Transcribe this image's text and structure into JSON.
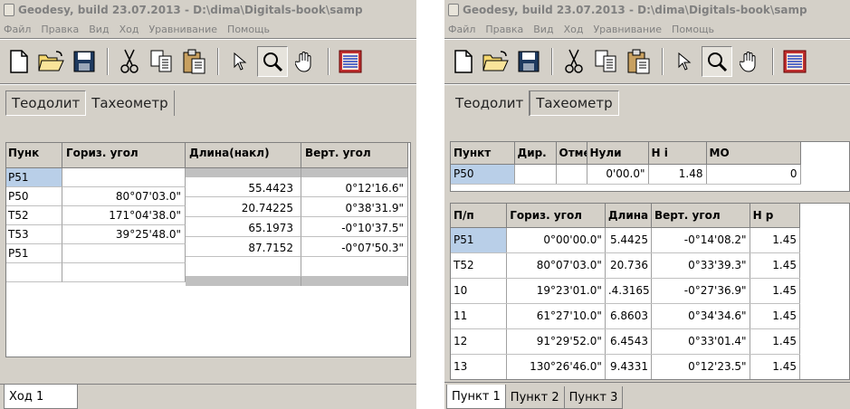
{
  "window1": {
    "title": "Geodesy, build 23.07.2013 - D:\\dima\\Digitals-book\\samp",
    "menu": [
      "Файл",
      "Правка",
      "Вид",
      "Ход",
      "Уравнивание",
      "Помощь"
    ],
    "tabs": [
      "Теодолит",
      "Тахеометр"
    ],
    "grid_headers": [
      "Пунк",
      "Гориз. угол",
      "Длина(накл)",
      "Верт. угол"
    ],
    "points": [
      {
        "name": "P51",
        "angle": "",
        "length": "",
        "vert": ""
      },
      {
        "name": "P50",
        "angle": "80°07'03.0\"",
        "length": "55.4423",
        "vert": "0°12'16.6\""
      },
      {
        "name": "T52",
        "angle": "171°04'38.0\"",
        "length": "20.74225",
        "vert": "0°38'31.9\""
      },
      {
        "name": "T53",
        "angle": "39°25'48.0\"",
        "length": "65.1973",
        "vert": "-0°10'37.5\""
      },
      {
        "name": "P51",
        "angle": "",
        "length": "87.7152",
        "vert": "-0°07'50.3\""
      }
    ],
    "bottom_tab": "Ход 1"
  },
  "window2": {
    "title": "Geodesy, build 23.07.2013 - D:\\dima\\Digitals-book\\samp",
    "menu": [
      "Файл",
      "Правка",
      "Вид",
      "Ход",
      "Уравнивание",
      "Помощь"
    ],
    "tabs": [
      "Теодолит",
      "Тахеометр"
    ],
    "station_headers": [
      "Пункт",
      "Дир. ",
      "Отме",
      "Нули",
      "H i",
      "MO"
    ],
    "station_row": [
      "P50",
      "",
      "",
      "0'00.0\"",
      "1.48",
      "0"
    ],
    "obs_headers": [
      "П/п",
      "Гориз. угол",
      "Длина",
      "Верт. угол",
      "H р"
    ],
    "obs_rows": [
      [
        "P51",
        "0°00'00.0\"",
        "5.4425",
        "-0°14'08.2\"",
        "1.45"
      ],
      [
        "T52",
        "80°07'03.0\"",
        "20.736",
        "0°33'39.3\"",
        "1.45"
      ],
      [
        "10",
        "19°23'01.0\"",
        ".4.3165",
        "-0°27'36.9\"",
        "1.45"
      ],
      [
        "11",
        "61°27'10.0\"",
        "6.8603",
        "0°34'34.6\"",
        "1.45"
      ],
      [
        "12",
        "91°29'52.0\"",
        "6.4543",
        "0°33'01.4\"",
        "1.45"
      ],
      [
        "13",
        "130°26'46.0\"",
        "9.4331",
        "0°12'23.5\"",
        "1.45"
      ]
    ],
    "bottom_tabs": [
      "Пункт 1",
      "Пункт 2",
      "Пункт 3"
    ]
  }
}
